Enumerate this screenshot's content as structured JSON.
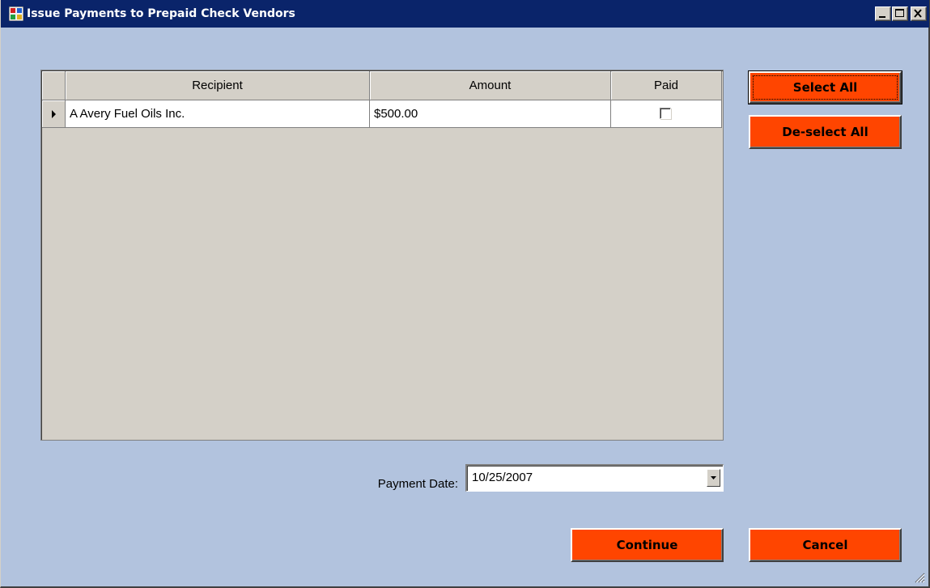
{
  "window": {
    "title": "Issue Payments to Prepaid Check Vendors",
    "icon": "app-window-icon",
    "controls": [
      "minimize-icon",
      "maximize-icon",
      "close-icon"
    ]
  },
  "grid": {
    "columns": [
      "Recipient",
      "Amount",
      "Paid"
    ],
    "rows": [
      {
        "recipient": "A Avery Fuel Oils Inc.",
        "amount": "$500.00",
        "paid": false,
        "current": true
      }
    ]
  },
  "buttons": {
    "select_all": "Select All",
    "deselect_all": "De-select All",
    "continue": "Continue",
    "cancel": "Cancel"
  },
  "payment_date": {
    "label": "Payment Date:",
    "value": "10/25/2007"
  },
  "colors": {
    "title_bar": "#0a246a",
    "background": "#b2c3de",
    "button_accent": "#ff4500",
    "grid_background": "#d4d0c8"
  }
}
